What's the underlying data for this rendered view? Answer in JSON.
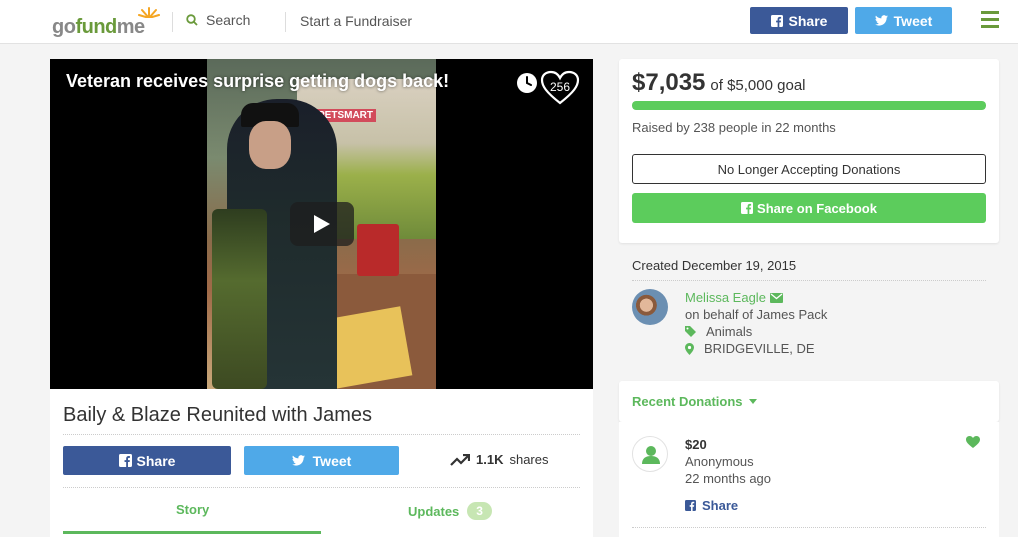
{
  "header": {
    "logo_part1": "go",
    "logo_part2": "fund",
    "logo_part3": "me",
    "search_label": "Search",
    "start_label": "Start a Fundraiser",
    "share_label": "Share",
    "tweet_label": "Tweet"
  },
  "video": {
    "title": "Veteran receives surprise getting dogs back!",
    "likes": "256",
    "sign_text": "PETSMART"
  },
  "campaign": {
    "title": "Baily & Blaze Reunited with James",
    "share_label": "Share",
    "tweet_label": "Tweet",
    "shares_count": "1.1K",
    "shares_label": "shares",
    "tabs": [
      {
        "label": "Story"
      },
      {
        "label": "Updates",
        "badge": "3"
      }
    ]
  },
  "donate": {
    "raised": "$7,035",
    "goal": "of $5,000 goal",
    "progress": 1.0,
    "raised_by": "Raised by 238 people in 22 months",
    "no_donations_label": "No Longer Accepting Donations",
    "share_fb_label": "Share on Facebook"
  },
  "organizer": {
    "created": "Created December 19, 2015",
    "name": "Melissa Eagle",
    "behalf": "on behalf of James Pack",
    "category": "Animals",
    "location": "BRIDGEVILLE, DE"
  },
  "recent": {
    "label": "Recent Donations",
    "donations": [
      {
        "amount": "$20",
        "name": "Anonymous",
        "time": "22 months ago",
        "share_label": "Share"
      }
    ]
  },
  "colors": {
    "brand_green": "#5cb85c",
    "facebook_blue": "#3b5998",
    "twitter_blue": "#4fa9e8",
    "progress_green": "#5ccc5c"
  }
}
